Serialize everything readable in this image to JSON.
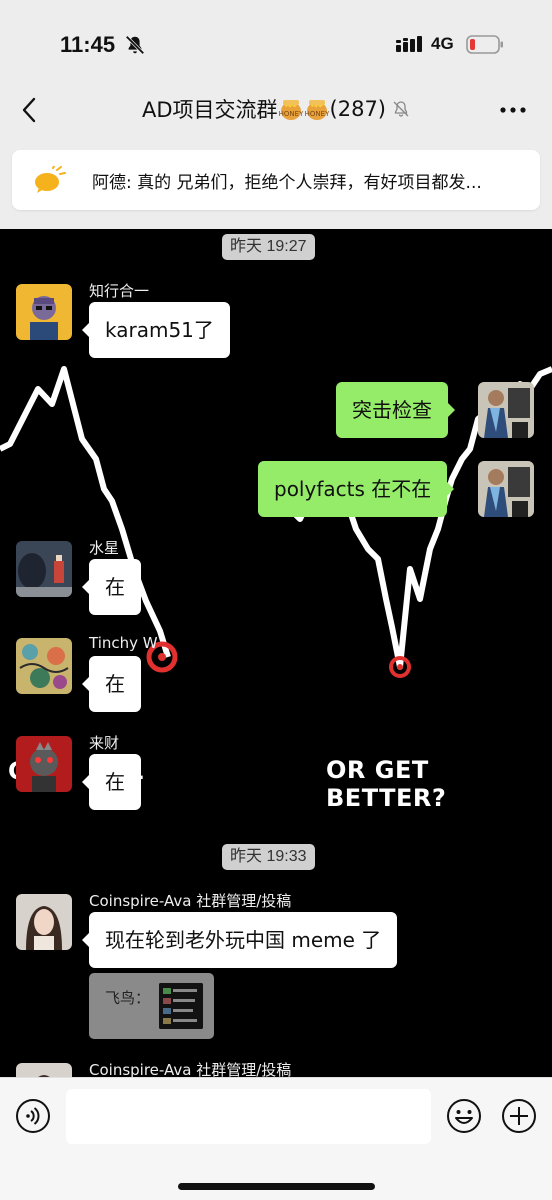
{
  "status_bar": {
    "time": "11:45",
    "network": "4G",
    "icons": [
      "bell-off-icon",
      "signal-icon",
      "battery-low-icon"
    ]
  },
  "header": {
    "title": "AD项目交流群",
    "title_emojis": [
      "honey-pot-emoji",
      "honey-pot-emoji"
    ],
    "member_count": "(287)",
    "back_icon": "chevron-left-icon",
    "more_icon": "ellipsis-icon",
    "mute_icon": "bell-muted-icon"
  },
  "pinned": {
    "icon": "speech-bubble-icon",
    "text": "阿德: 真的 兄弟们，拒绝个人崇拜，有好项目都发..."
  },
  "chat": {
    "background_text": "OR GET BETTER?",
    "timestamps": [
      "昨天 19:27",
      "昨天 19:33"
    ],
    "messages": [
      {
        "sender": "知行合一",
        "text": "karam51了",
        "side": "left"
      },
      {
        "sender": "",
        "text": "突击检查",
        "side": "right"
      },
      {
        "sender": "",
        "text": "polyfacts 在不在",
        "side": "right"
      },
      {
        "sender": "水星",
        "text": "在",
        "side": "left"
      },
      {
        "sender": "Tinchy W",
        "text": "在",
        "side": "left"
      },
      {
        "sender": "来财",
        "text": "在",
        "side": "left"
      },
      {
        "sender": "Coinspire-Ava 社群管理/投稿",
        "text": "现在轮到老外玩中国 meme 了",
        "side": "left"
      },
      {
        "sender": "Coinspire-Ava 社群管理/投稿",
        "text": "",
        "side": "left"
      }
    ],
    "quote": {
      "label": "飞鸟："
    }
  },
  "input_bar": {
    "voice_icon": "voice-icon",
    "emoji_icon": "smiley-icon",
    "plus_icon": "plus-icon"
  },
  "colors": {
    "my_bubble": "#95ec69",
    "other_bubble": "#ffffff",
    "header_bg": "#ededed",
    "battery_low": "#e53935",
    "marker_red": "#e0312f"
  }
}
